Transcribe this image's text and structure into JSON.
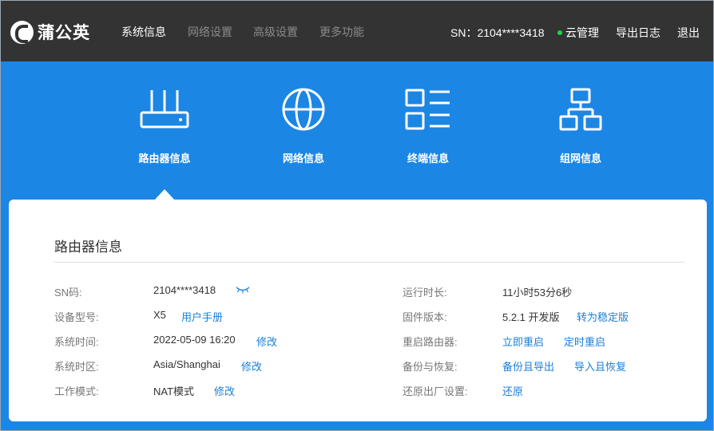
{
  "header": {
    "brand": "蒲公英",
    "nav": [
      "系统信息",
      "网络设置",
      "高级设置",
      "更多功能"
    ],
    "sn": "SN：2104****3418",
    "cloud": "云管理",
    "export_log": "导出日志",
    "logout": "退出"
  },
  "categories": [
    "路由器信息",
    "网络信息",
    "终端信息",
    "组网信息"
  ],
  "card": {
    "title": "路由器信息",
    "left": [
      {
        "label": "SN码:",
        "value": "2104****3418"
      },
      {
        "label": "设备型号:",
        "value": "X5",
        "links": [
          "用户手册"
        ]
      },
      {
        "label": "系统时间:",
        "value": "2022-05-09 16:20",
        "links": [
          "修改"
        ]
      },
      {
        "label": "系统时区:",
        "value": "Asia/Shanghai",
        "links": [
          "修改"
        ]
      },
      {
        "label": "工作模式:",
        "value": "NAT模式",
        "links": [
          "修改"
        ]
      }
    ],
    "right": [
      {
        "label": "运行时长:",
        "value": "11小时53分6秒"
      },
      {
        "label": "固件版本:",
        "value": "5.2.1 开发版",
        "links": [
          "转为稳定版"
        ]
      },
      {
        "label": "重启路由器:",
        "links": [
          "立即重启",
          "定时重启"
        ]
      },
      {
        "label": "备份与恢复:",
        "links": [
          "备份且导出",
          "导入且恢复"
        ]
      },
      {
        "label": "还原出厂设置:",
        "links": [
          "还原"
        ]
      }
    ]
  },
  "colors": {
    "header_bg": "#333333",
    "accent_blue": "#1c86e4",
    "link": "#1a7fd9",
    "online": "#22d14a"
  },
  "icons": [
    "router-icon",
    "globe-icon",
    "list-icon",
    "network-tree-icon",
    "eye-closed-icon"
  ]
}
